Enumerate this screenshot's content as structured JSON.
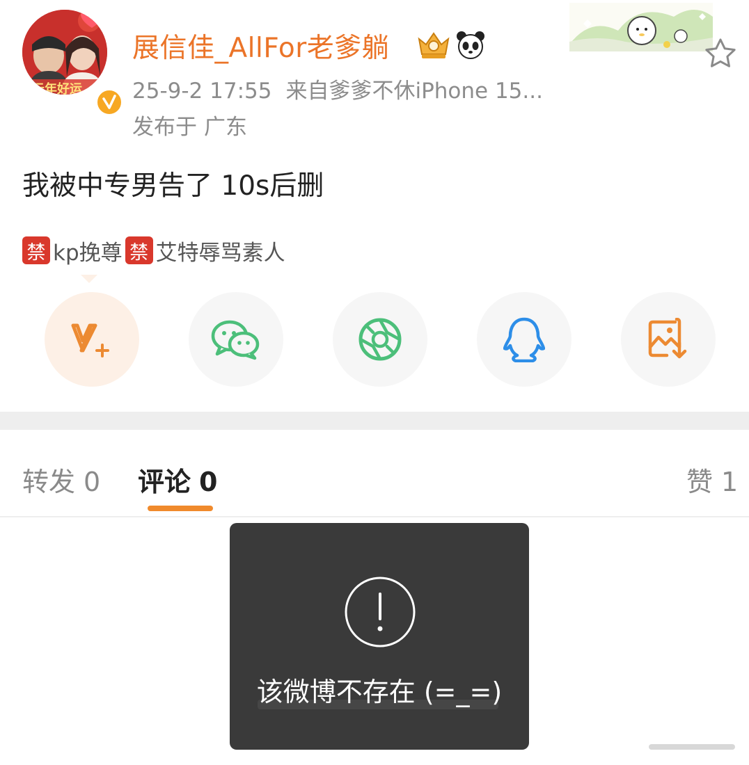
{
  "post": {
    "author": "展信佳_AllFor老爹躺",
    "date": "25-9-2 17:55",
    "source_prefix": "来自",
    "source_name": "爹爹不休iPhone 15...",
    "location_prefix": "发布于",
    "location": "广东",
    "text": "我被中专男告了 10s后删",
    "avatar_caption": "元年好运",
    "tags": [
      {
        "icon": "禁",
        "label": "kp挽尊"
      },
      {
        "icon": "禁",
        "label": "艾特辱骂素人"
      }
    ]
  },
  "share": {
    "targets": [
      {
        "icon": "vplus-icon"
      },
      {
        "icon": "wechat-icon"
      },
      {
        "icon": "moments-icon"
      },
      {
        "icon": "qq-icon"
      },
      {
        "icon": "save-image-icon"
      }
    ]
  },
  "tabs": {
    "repost": {
      "label": "转发",
      "count": "0"
    },
    "comment": {
      "label": "评论",
      "count": "0",
      "selected": true
    },
    "like": {
      "label": "赞",
      "count": "1"
    }
  },
  "toast": {
    "icon": "exclamation-icon",
    "message": "该微博不存在 (=_=)"
  },
  "colors": {
    "accent": "#f08a2c",
    "username": "#eb7428",
    "toast_bg": "#3a3a3a",
    "ban_tag": "#d9382c"
  }
}
